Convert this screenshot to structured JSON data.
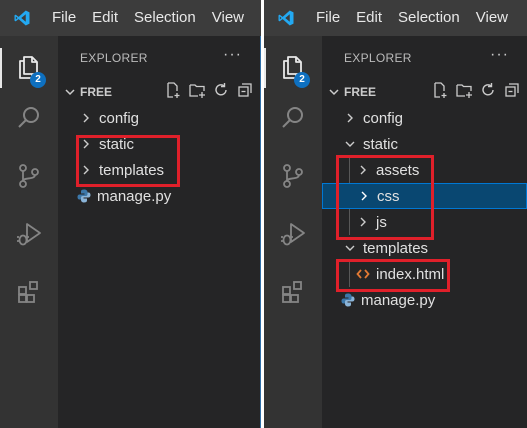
{
  "colors": {
    "highlight": "#e0202a",
    "accent": "#0e70c0",
    "selection": "#094771"
  },
  "left": {
    "menu": [
      "File",
      "Edit",
      "Selection",
      "View"
    ],
    "badge_count": "2",
    "explorer_title": "EXPLORER",
    "more": "···",
    "section_title": "FREE",
    "tree": [
      {
        "label": "config",
        "icon": "chevron-right-icon"
      },
      {
        "label": "static",
        "icon": "chevron-right-icon"
      },
      {
        "label": "templates",
        "icon": "chevron-right-icon"
      },
      {
        "label": "manage.py",
        "icon": "python-file-icon"
      }
    ]
  },
  "right": {
    "menu": [
      "File",
      "Edit",
      "Selection",
      "View"
    ],
    "badge_count": "2",
    "explorer_title": "EXPLORER",
    "more": "···",
    "section_title": "FREE",
    "tree": [
      {
        "label": "config",
        "icon": "chevron-right-icon"
      },
      {
        "label": "static",
        "icon": "chevron-down-icon"
      },
      {
        "label": "assets",
        "icon": "chevron-right-icon"
      },
      {
        "label": "css",
        "icon": "chevron-right-icon",
        "selected": true
      },
      {
        "label": "js",
        "icon": "chevron-right-icon"
      },
      {
        "label": "templates",
        "icon": "chevron-down-icon"
      },
      {
        "label": "index.html",
        "icon": "html-file-icon"
      },
      {
        "label": "manage.py",
        "icon": "python-file-icon"
      }
    ]
  }
}
